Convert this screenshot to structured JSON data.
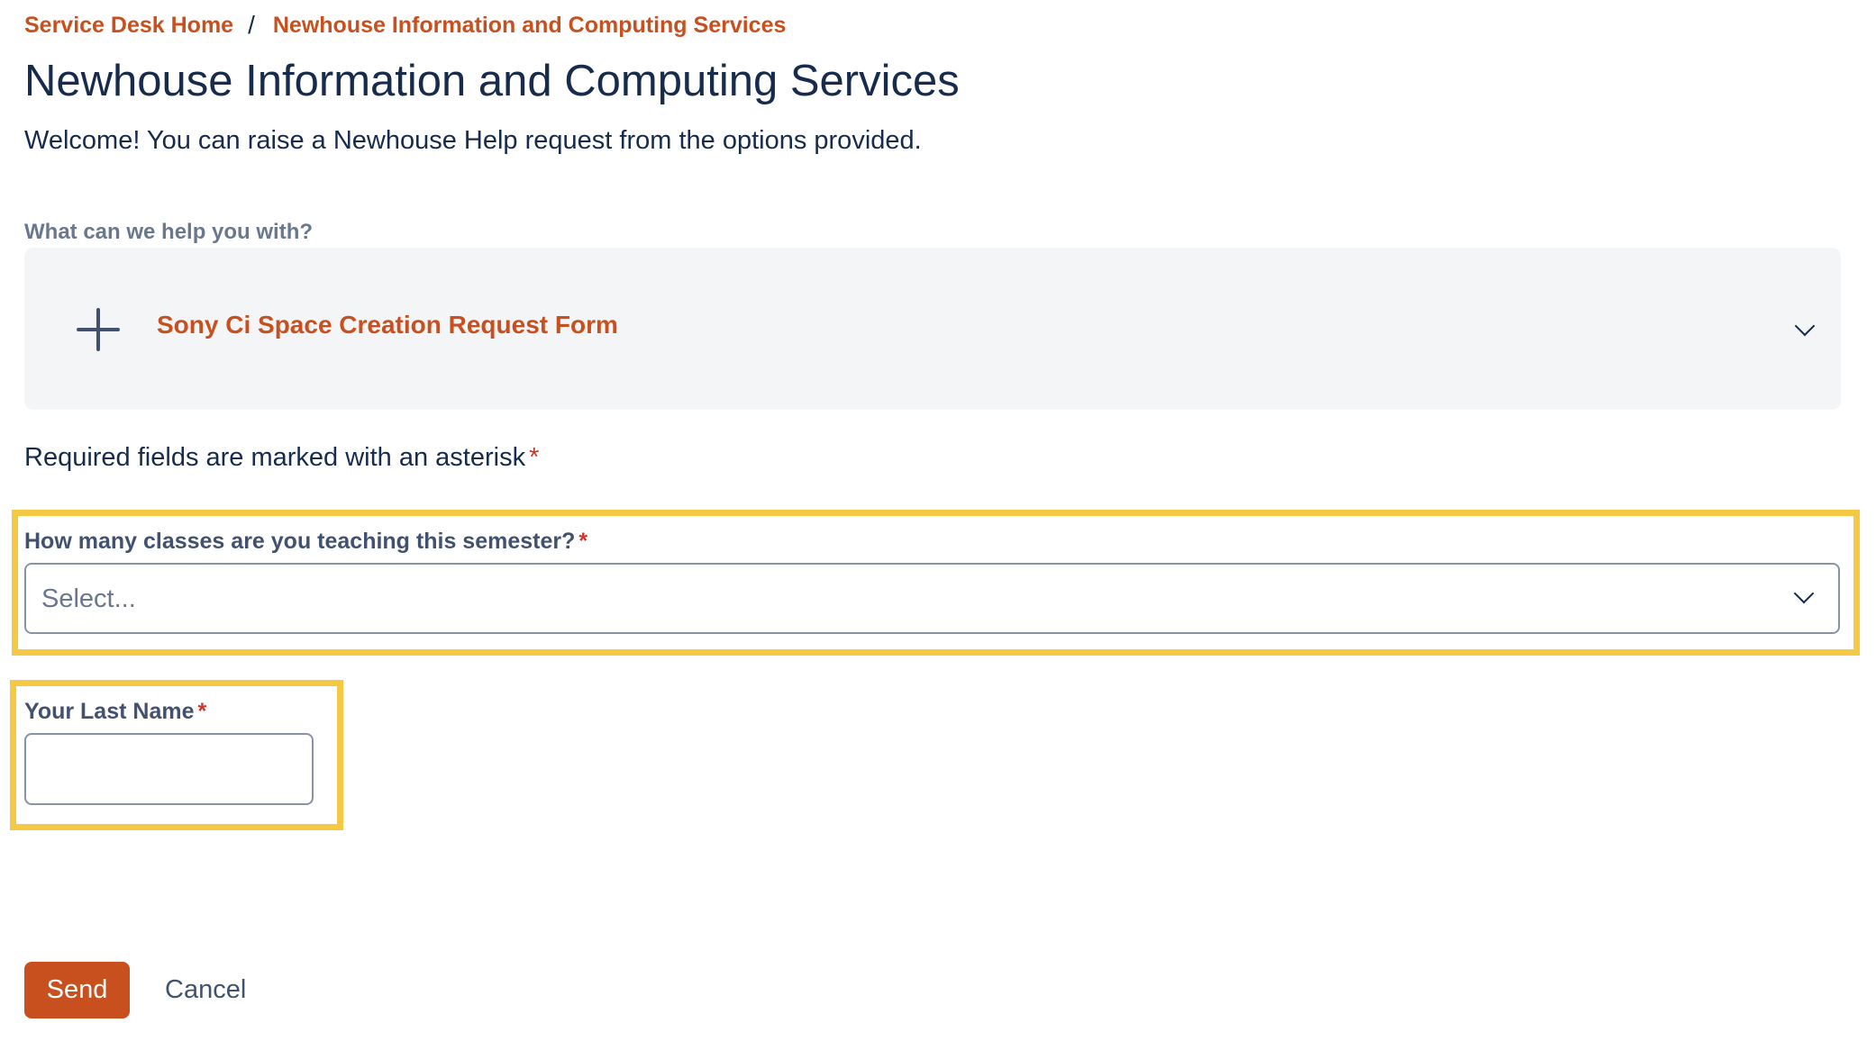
{
  "breadcrumb": {
    "home": "Service Desk Home",
    "separator": "/",
    "current": "Newhouse Information and Computing Services"
  },
  "page": {
    "title": "Newhouse Information and Computing Services",
    "welcome": "Welcome! You can raise a Newhouse Help request from the options provided."
  },
  "request_type": {
    "label": "What can we help you with?",
    "icon": "plus-icon",
    "selected": "Sony Ci Space Creation Request Form",
    "expand_icon": "chevron-down-icon"
  },
  "form": {
    "required_note": "Required fields are marked with an asterisk",
    "required_marker": "*",
    "classes_field": {
      "label": "How many classes are you teaching this semester?",
      "placeholder": "Select...",
      "value": ""
    },
    "last_name_field": {
      "label": "Your Last Name",
      "value": ""
    }
  },
  "actions": {
    "send_label": "Send",
    "cancel_label": "Cancel"
  },
  "colors": {
    "accent": "#c8501f",
    "heading": "#172b4d",
    "highlight": "#f6c944",
    "required": "#c9372c",
    "card_background": "#f4f5f7"
  }
}
